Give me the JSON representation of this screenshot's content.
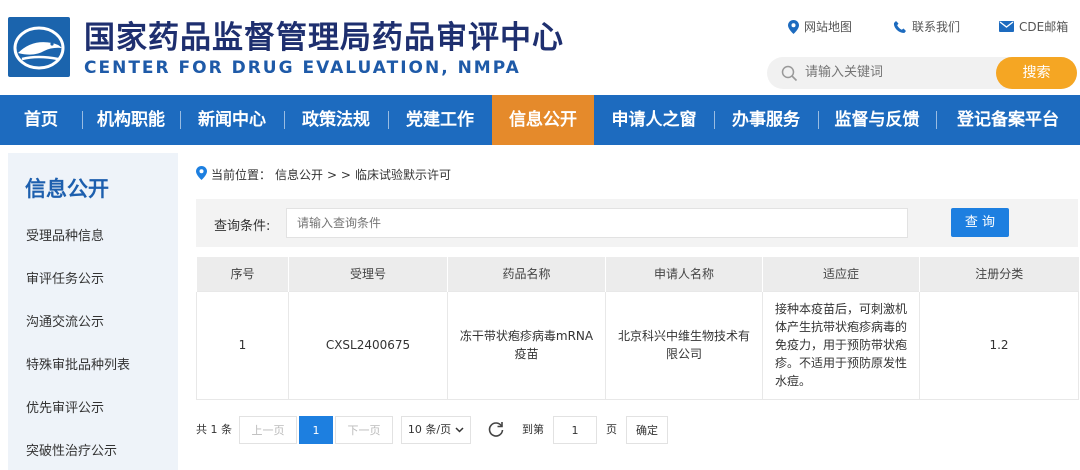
{
  "header": {
    "title_cn": "国家药品监督管理局药品审评中心",
    "title_en": "CENTER FOR DRUG EVALUATION, NMPA",
    "links": {
      "sitemap": "网站地图",
      "contact": "联系我们",
      "mail": "CDE邮箱"
    },
    "search": {
      "placeholder": "请输入关键词",
      "button": "搜索"
    }
  },
  "nav": {
    "items": [
      {
        "label": "首页",
        "width": 82
      },
      {
        "label": "机构职能",
        "width": 98
      },
      {
        "label": "新闻中心",
        "width": 104
      },
      {
        "label": "政策法规",
        "width": 104
      },
      {
        "label": "党建工作",
        "width": 104
      },
      {
        "label": "信息公开",
        "width": 102
      },
      {
        "label": "申请人之窗",
        "width": 120
      },
      {
        "label": "办事服务",
        "width": 104
      },
      {
        "label": "监督与反馈",
        "width": 118
      },
      {
        "label": "登记备案平台",
        "width": 144
      }
    ],
    "active_index": 5
  },
  "sidebar": {
    "title": "信息公开",
    "items": [
      {
        "label": "受理品种信息"
      },
      {
        "label": "审评任务公示"
      },
      {
        "label": "沟通交流公示"
      },
      {
        "label": "特殊审批品种列表"
      },
      {
        "label": "优先审评公示"
      },
      {
        "label": "突破性治疗公示"
      }
    ]
  },
  "breadcrumb": {
    "prefix": "当前位置：",
    "section": "信息公开",
    "separator": ">  >",
    "current": "临床试验默示许可"
  },
  "query": {
    "label": "查询条件:",
    "placeholder": "请输入查询条件",
    "button": "查 询"
  },
  "table": {
    "columns": [
      "序号",
      "受理号",
      "药品名称",
      "申请人名称",
      "适应症",
      "注册分类"
    ],
    "rows": [
      {
        "index": "1",
        "accept_no": "CXSL2400675",
        "drug_name": "冻干带状疱疹病毒mRNA疫苗",
        "applicant": "北京科兴中维生物技术有限公司",
        "indication": "接种本疫苗后，可刺激机体产生抗带状疱疹病毒的免疫力，用于预防带状疱疹。不适用于预防原发性水痘。",
        "category": "1.2"
      }
    ]
  },
  "pager": {
    "total": "共 1 条",
    "prev": "上一页",
    "current_page": "1",
    "next": "下一页",
    "page_size": "10 条/页",
    "goto": "到第",
    "goto_value": "1",
    "unit": "页",
    "confirm": "确定"
  },
  "colors": {
    "nav_bg": "#1d6bbf",
    "nav_active": "#e58a2b",
    "search_button": "#f5a623",
    "primary_button": "#1d7fe0",
    "title": "#1e2f6f"
  }
}
